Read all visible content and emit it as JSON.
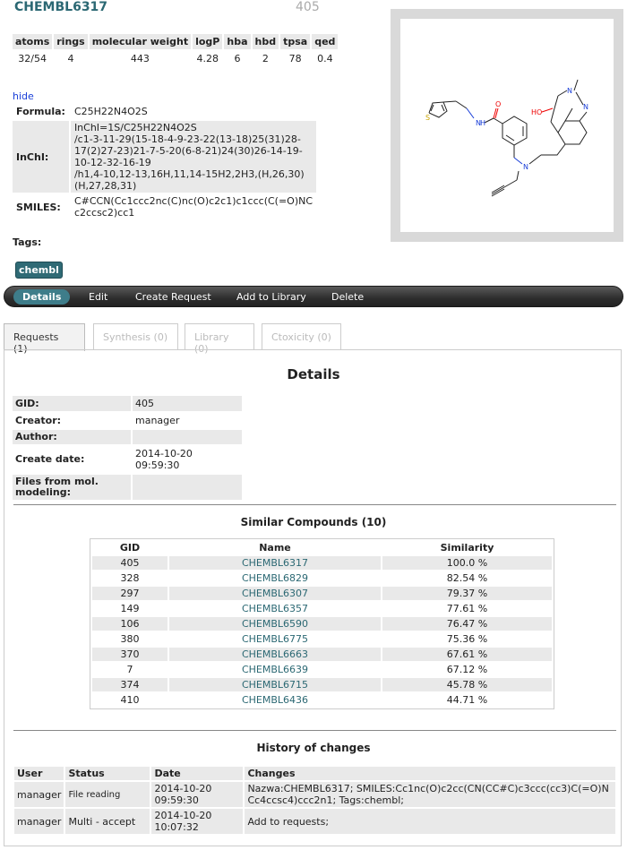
{
  "compound": {
    "name": "CHEMBL6317",
    "gid": "405"
  },
  "props": {
    "headers": [
      "atoms",
      "rings",
      "molecular weight",
      "logP",
      "hba",
      "hbd",
      "tpsa",
      "qed"
    ],
    "values": [
      "32/54",
      "4",
      "443",
      "4.28",
      "6",
      "2",
      "78",
      "0.4"
    ]
  },
  "hide_label": "hide",
  "info": {
    "formula_label": "Formula:",
    "formula": "C25H22N4O2S",
    "inchi_label": "InChI:",
    "inchi_lines": [
      "InChI=1S/C25H22N4O2S",
      "/c1-3-11-29(15-18-4-9-23-22(13-18)25(31)28-",
      "17(2)27-23)21-7-5-20(6-8-21)24(30)26-14-19-",
      "10-12-32-16-19",
      "/h1,4-10,12-13,16H,11,14-15H2,2H3,(H,26,30)",
      "(H,27,28,31)"
    ],
    "smiles_label": "SMILES:",
    "smiles_lines": [
      "C#CCN(Cc1ccc2nc(C)nc(O)c2c1)c1ccc(C(=O)NC",
      "c2ccsc2)cc1"
    ]
  },
  "tags_label": "Tags:",
  "tag": "chembl",
  "molecule_atoms": {
    "o_top": "O",
    "n_amide": "N",
    "h_amide": "H",
    "s": "S",
    "n_ring1": "N",
    "n_ring2": "N",
    "ho": "HO",
    "n_amine": "N"
  },
  "nav": {
    "details": "Details",
    "edit": "Edit",
    "create_request": "Create Request",
    "add_library": "Add to Library",
    "delete": "Delete"
  },
  "tabs": {
    "requests": "Requests (1)",
    "synthesis": "Synthesis (0)",
    "library": "Library (0)",
    "ctoxicity": "Ctoxicity (0)"
  },
  "details": {
    "heading": "Details",
    "rows": [
      {
        "label": "GID:",
        "value": "405"
      },
      {
        "label": "Creator:",
        "value": "manager"
      },
      {
        "label": "Author:",
        "value": ""
      },
      {
        "label": "Create date:",
        "value": "2014-10-20 09:59:30"
      },
      {
        "label": "Files from mol. modeling:",
        "value": ""
      }
    ]
  },
  "similar": {
    "heading": "Similar Compounds (10)",
    "headers": [
      "GID",
      "Name",
      "Similarity"
    ],
    "rows": [
      {
        "gid": "405",
        "name": "CHEMBL6317",
        "sim": "100.0 %"
      },
      {
        "gid": "328",
        "name": "CHEMBL6829",
        "sim": "82.54 %"
      },
      {
        "gid": "297",
        "name": "CHEMBL6307",
        "sim": "79.37 %"
      },
      {
        "gid": "149",
        "name": "CHEMBL6357",
        "sim": "77.61 %"
      },
      {
        "gid": "106",
        "name": "CHEMBL6590",
        "sim": "76.47 %"
      },
      {
        "gid": "380",
        "name": "CHEMBL6775",
        "sim": "75.36 %"
      },
      {
        "gid": "370",
        "name": "CHEMBL6663",
        "sim": "67.61 %"
      },
      {
        "gid": "7",
        "name": "CHEMBL6639",
        "sim": "67.12 %"
      },
      {
        "gid": "374",
        "name": "CHEMBL6715",
        "sim": "45.78 %"
      },
      {
        "gid": "410",
        "name": "CHEMBL6436",
        "sim": "44.71 %"
      }
    ]
  },
  "history": {
    "heading": "History of changes",
    "headers": [
      "User",
      "Status",
      "Date",
      "Changes"
    ],
    "rows": [
      {
        "user": "manager",
        "status": "File reading",
        "date": "2014-10-20 09:59:30",
        "changes": "Nazwa:CHEMBL6317; SMILES:Cc1nc(O)c2cc(CN(CC#C)c3ccc(cc3)C(=O)NCc4ccsc4)ccc2n1; Tags:chembl;"
      },
      {
        "user": "manager",
        "status": "Multi - accept",
        "date": "2014-10-20 10:07:32",
        "changes": "Add to requests;"
      }
    ]
  }
}
